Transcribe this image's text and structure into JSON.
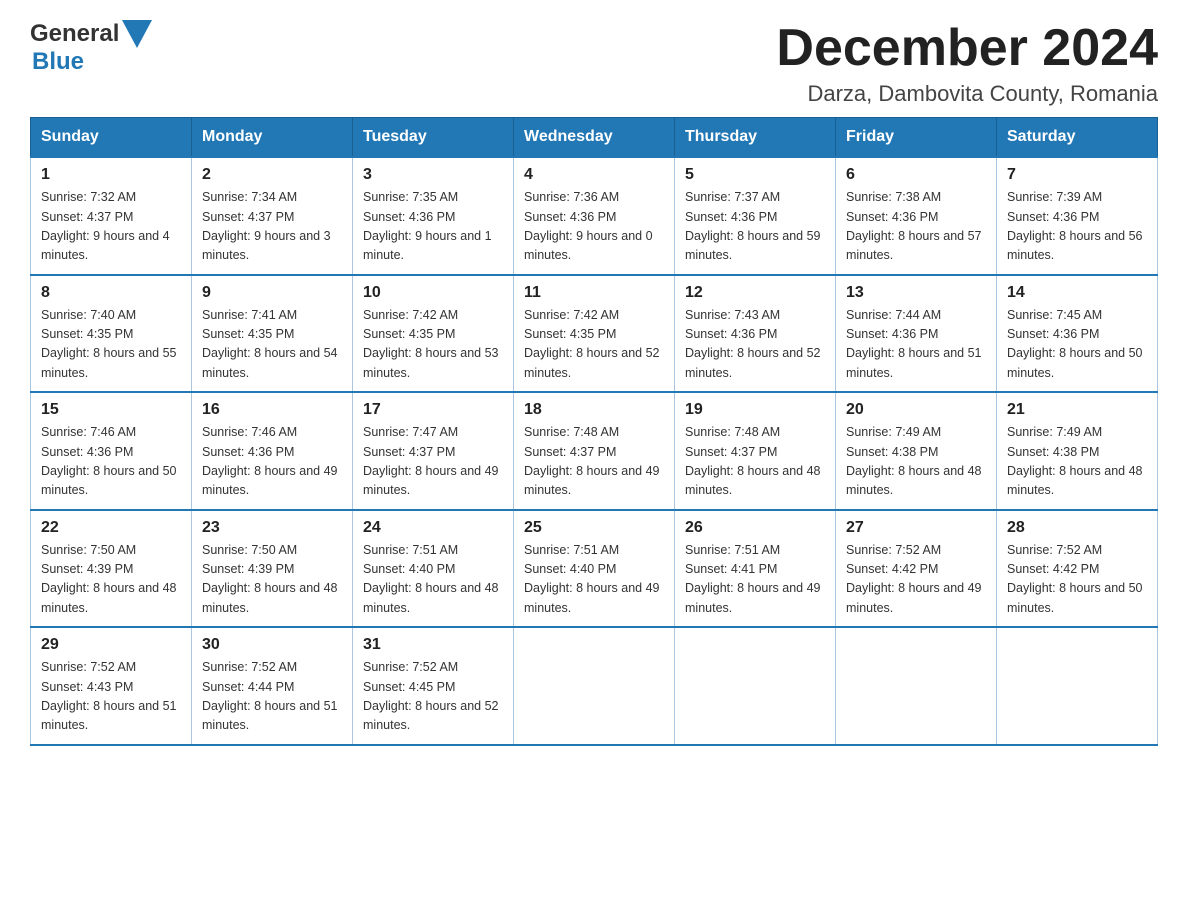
{
  "logo": {
    "text_general": "General",
    "text_blue": "Blue"
  },
  "title": "December 2024",
  "location": "Darza, Dambovita County, Romania",
  "days_of_week": [
    "Sunday",
    "Monday",
    "Tuesday",
    "Wednesday",
    "Thursday",
    "Friday",
    "Saturday"
  ],
  "weeks": [
    [
      {
        "day": "1",
        "sunrise": "7:32 AM",
        "sunset": "4:37 PM",
        "daylight": "9 hours and 4 minutes."
      },
      {
        "day": "2",
        "sunrise": "7:34 AM",
        "sunset": "4:37 PM",
        "daylight": "9 hours and 3 minutes."
      },
      {
        "day": "3",
        "sunrise": "7:35 AM",
        "sunset": "4:36 PM",
        "daylight": "9 hours and 1 minute."
      },
      {
        "day": "4",
        "sunrise": "7:36 AM",
        "sunset": "4:36 PM",
        "daylight": "9 hours and 0 minutes."
      },
      {
        "day": "5",
        "sunrise": "7:37 AM",
        "sunset": "4:36 PM",
        "daylight": "8 hours and 59 minutes."
      },
      {
        "day": "6",
        "sunrise": "7:38 AM",
        "sunset": "4:36 PM",
        "daylight": "8 hours and 57 minutes."
      },
      {
        "day": "7",
        "sunrise": "7:39 AM",
        "sunset": "4:36 PM",
        "daylight": "8 hours and 56 minutes."
      }
    ],
    [
      {
        "day": "8",
        "sunrise": "7:40 AM",
        "sunset": "4:35 PM",
        "daylight": "8 hours and 55 minutes."
      },
      {
        "day": "9",
        "sunrise": "7:41 AM",
        "sunset": "4:35 PM",
        "daylight": "8 hours and 54 minutes."
      },
      {
        "day": "10",
        "sunrise": "7:42 AM",
        "sunset": "4:35 PM",
        "daylight": "8 hours and 53 minutes."
      },
      {
        "day": "11",
        "sunrise": "7:42 AM",
        "sunset": "4:35 PM",
        "daylight": "8 hours and 52 minutes."
      },
      {
        "day": "12",
        "sunrise": "7:43 AM",
        "sunset": "4:36 PM",
        "daylight": "8 hours and 52 minutes."
      },
      {
        "day": "13",
        "sunrise": "7:44 AM",
        "sunset": "4:36 PM",
        "daylight": "8 hours and 51 minutes."
      },
      {
        "day": "14",
        "sunrise": "7:45 AM",
        "sunset": "4:36 PM",
        "daylight": "8 hours and 50 minutes."
      }
    ],
    [
      {
        "day": "15",
        "sunrise": "7:46 AM",
        "sunset": "4:36 PM",
        "daylight": "8 hours and 50 minutes."
      },
      {
        "day": "16",
        "sunrise": "7:46 AM",
        "sunset": "4:36 PM",
        "daylight": "8 hours and 49 minutes."
      },
      {
        "day": "17",
        "sunrise": "7:47 AM",
        "sunset": "4:37 PM",
        "daylight": "8 hours and 49 minutes."
      },
      {
        "day": "18",
        "sunrise": "7:48 AM",
        "sunset": "4:37 PM",
        "daylight": "8 hours and 49 minutes."
      },
      {
        "day": "19",
        "sunrise": "7:48 AM",
        "sunset": "4:37 PM",
        "daylight": "8 hours and 48 minutes."
      },
      {
        "day": "20",
        "sunrise": "7:49 AM",
        "sunset": "4:38 PM",
        "daylight": "8 hours and 48 minutes."
      },
      {
        "day": "21",
        "sunrise": "7:49 AM",
        "sunset": "4:38 PM",
        "daylight": "8 hours and 48 minutes."
      }
    ],
    [
      {
        "day": "22",
        "sunrise": "7:50 AM",
        "sunset": "4:39 PM",
        "daylight": "8 hours and 48 minutes."
      },
      {
        "day": "23",
        "sunrise": "7:50 AM",
        "sunset": "4:39 PM",
        "daylight": "8 hours and 48 minutes."
      },
      {
        "day": "24",
        "sunrise": "7:51 AM",
        "sunset": "4:40 PM",
        "daylight": "8 hours and 48 minutes."
      },
      {
        "day": "25",
        "sunrise": "7:51 AM",
        "sunset": "4:40 PM",
        "daylight": "8 hours and 49 minutes."
      },
      {
        "day": "26",
        "sunrise": "7:51 AM",
        "sunset": "4:41 PM",
        "daylight": "8 hours and 49 minutes."
      },
      {
        "day": "27",
        "sunrise": "7:52 AM",
        "sunset": "4:42 PM",
        "daylight": "8 hours and 49 minutes."
      },
      {
        "day": "28",
        "sunrise": "7:52 AM",
        "sunset": "4:42 PM",
        "daylight": "8 hours and 50 minutes."
      }
    ],
    [
      {
        "day": "29",
        "sunrise": "7:52 AM",
        "sunset": "4:43 PM",
        "daylight": "8 hours and 51 minutes."
      },
      {
        "day": "30",
        "sunrise": "7:52 AM",
        "sunset": "4:44 PM",
        "daylight": "8 hours and 51 minutes."
      },
      {
        "day": "31",
        "sunrise": "7:52 AM",
        "sunset": "4:45 PM",
        "daylight": "8 hours and 52 minutes."
      },
      null,
      null,
      null,
      null
    ]
  ]
}
